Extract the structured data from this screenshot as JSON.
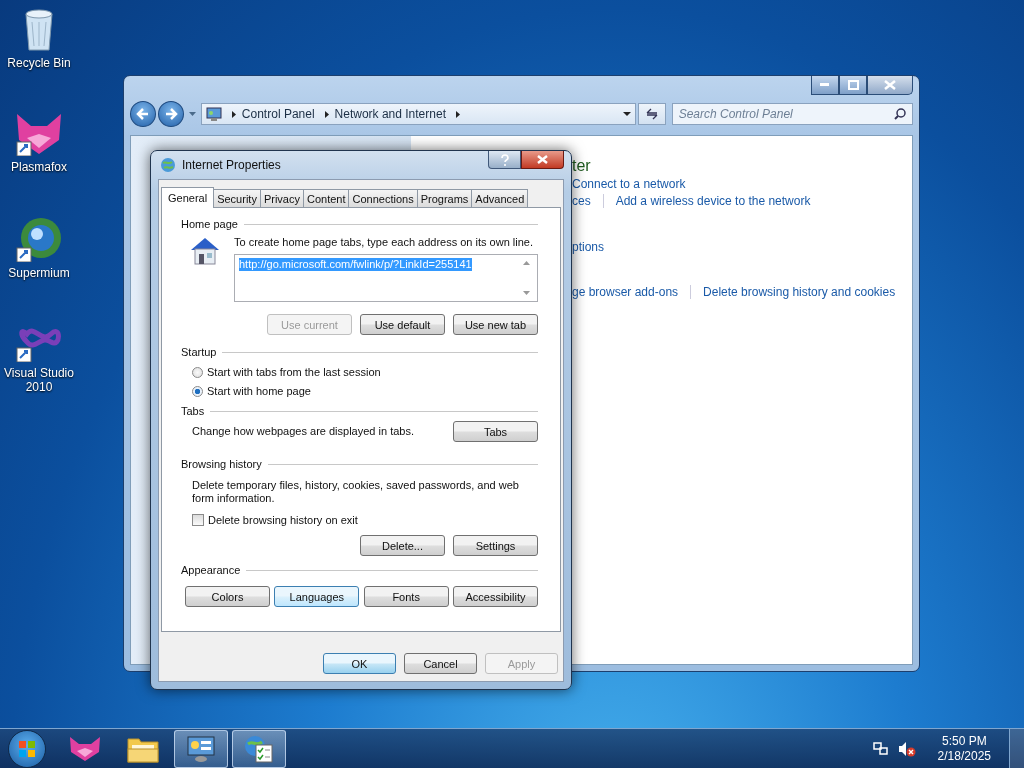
{
  "desktop_icons": [
    {
      "label": "Recycle Bin",
      "kind": "bin"
    },
    {
      "label": "Plasmafox",
      "kind": "fox"
    },
    {
      "label": "Supermium",
      "kind": "sphere"
    },
    {
      "label": "Visual Studio 2010",
      "kind": "vs"
    }
  ],
  "explorer": {
    "breadcrumb": [
      "Control Panel",
      "Network and Internet"
    ],
    "search": {
      "placeholder": "Search Control Panel"
    },
    "heading": "ter",
    "rows": [
      [
        {
          "text": "Connect to a network"
        }
      ],
      [
        {
          "text": "ces"
        },
        {
          "text": "Add a wireless device to the network"
        }
      ],
      [
        {
          "text": "ptions"
        }
      ],
      [
        {
          "text": "ge browser add-ons"
        },
        {
          "text": "Delete browsing history and cookies"
        }
      ]
    ]
  },
  "dialog": {
    "title": "Internet Properties",
    "tabs": [
      {
        "label": "General",
        "selected": true
      },
      {
        "label": "Security",
        "selected": false
      },
      {
        "label": "Privacy",
        "selected": false
      },
      {
        "label": "Content",
        "selected": false
      },
      {
        "label": "Connections",
        "selected": false
      },
      {
        "label": "Programs",
        "selected": false
      },
      {
        "label": "Advanced",
        "selected": false
      }
    ],
    "home_page": {
      "label": "Home page",
      "instruction": "To create home page tabs, type each address on its own line.",
      "value": "http://go.microsoft.com/fwlink/p/?LinkId=255141",
      "buttons": [
        {
          "label": "Use current",
          "disabled": true
        },
        {
          "label": "Use default",
          "disabled": false
        },
        {
          "label": "Use new tab",
          "disabled": false
        }
      ]
    },
    "startup": {
      "label": "Startup",
      "options": [
        {
          "label": "Start with tabs from the last session",
          "selected": false
        },
        {
          "label": "Start with home page",
          "selected": true
        }
      ]
    },
    "tabs_group": {
      "label": "Tabs",
      "text": "Change how webpages are displayed in tabs.",
      "button": "Tabs"
    },
    "browsing_history": {
      "label": "Browsing history",
      "text": "Delete temporary files, history, cookies, saved passwords, and web form information.",
      "checkbox": {
        "label": "Delete browsing history on exit",
        "checked": false
      },
      "buttons": [
        "Delete...",
        "Settings"
      ]
    },
    "appearance": {
      "label": "Appearance",
      "buttons": [
        {
          "label": "Colors",
          "hovered": false
        },
        {
          "label": "Languages",
          "hovered": true
        },
        {
          "label": "Fonts",
          "hovered": false
        },
        {
          "label": "Accessibility",
          "hovered": false
        }
      ]
    },
    "footer_buttons": [
      {
        "label": "OK",
        "disabled": false,
        "default": true
      },
      {
        "label": "Cancel",
        "disabled": false,
        "default": false
      },
      {
        "label": "Apply",
        "disabled": true,
        "default": false
      }
    ]
  },
  "taskbar": {
    "items": [
      {
        "kind": "fox",
        "selected": false
      },
      {
        "kind": "folder",
        "selected": false
      },
      {
        "kind": "control-panel",
        "selected": true
      },
      {
        "kind": "internet-options",
        "selected": true
      }
    ],
    "time": "5:50 PM",
    "date": "2/18/2025"
  }
}
